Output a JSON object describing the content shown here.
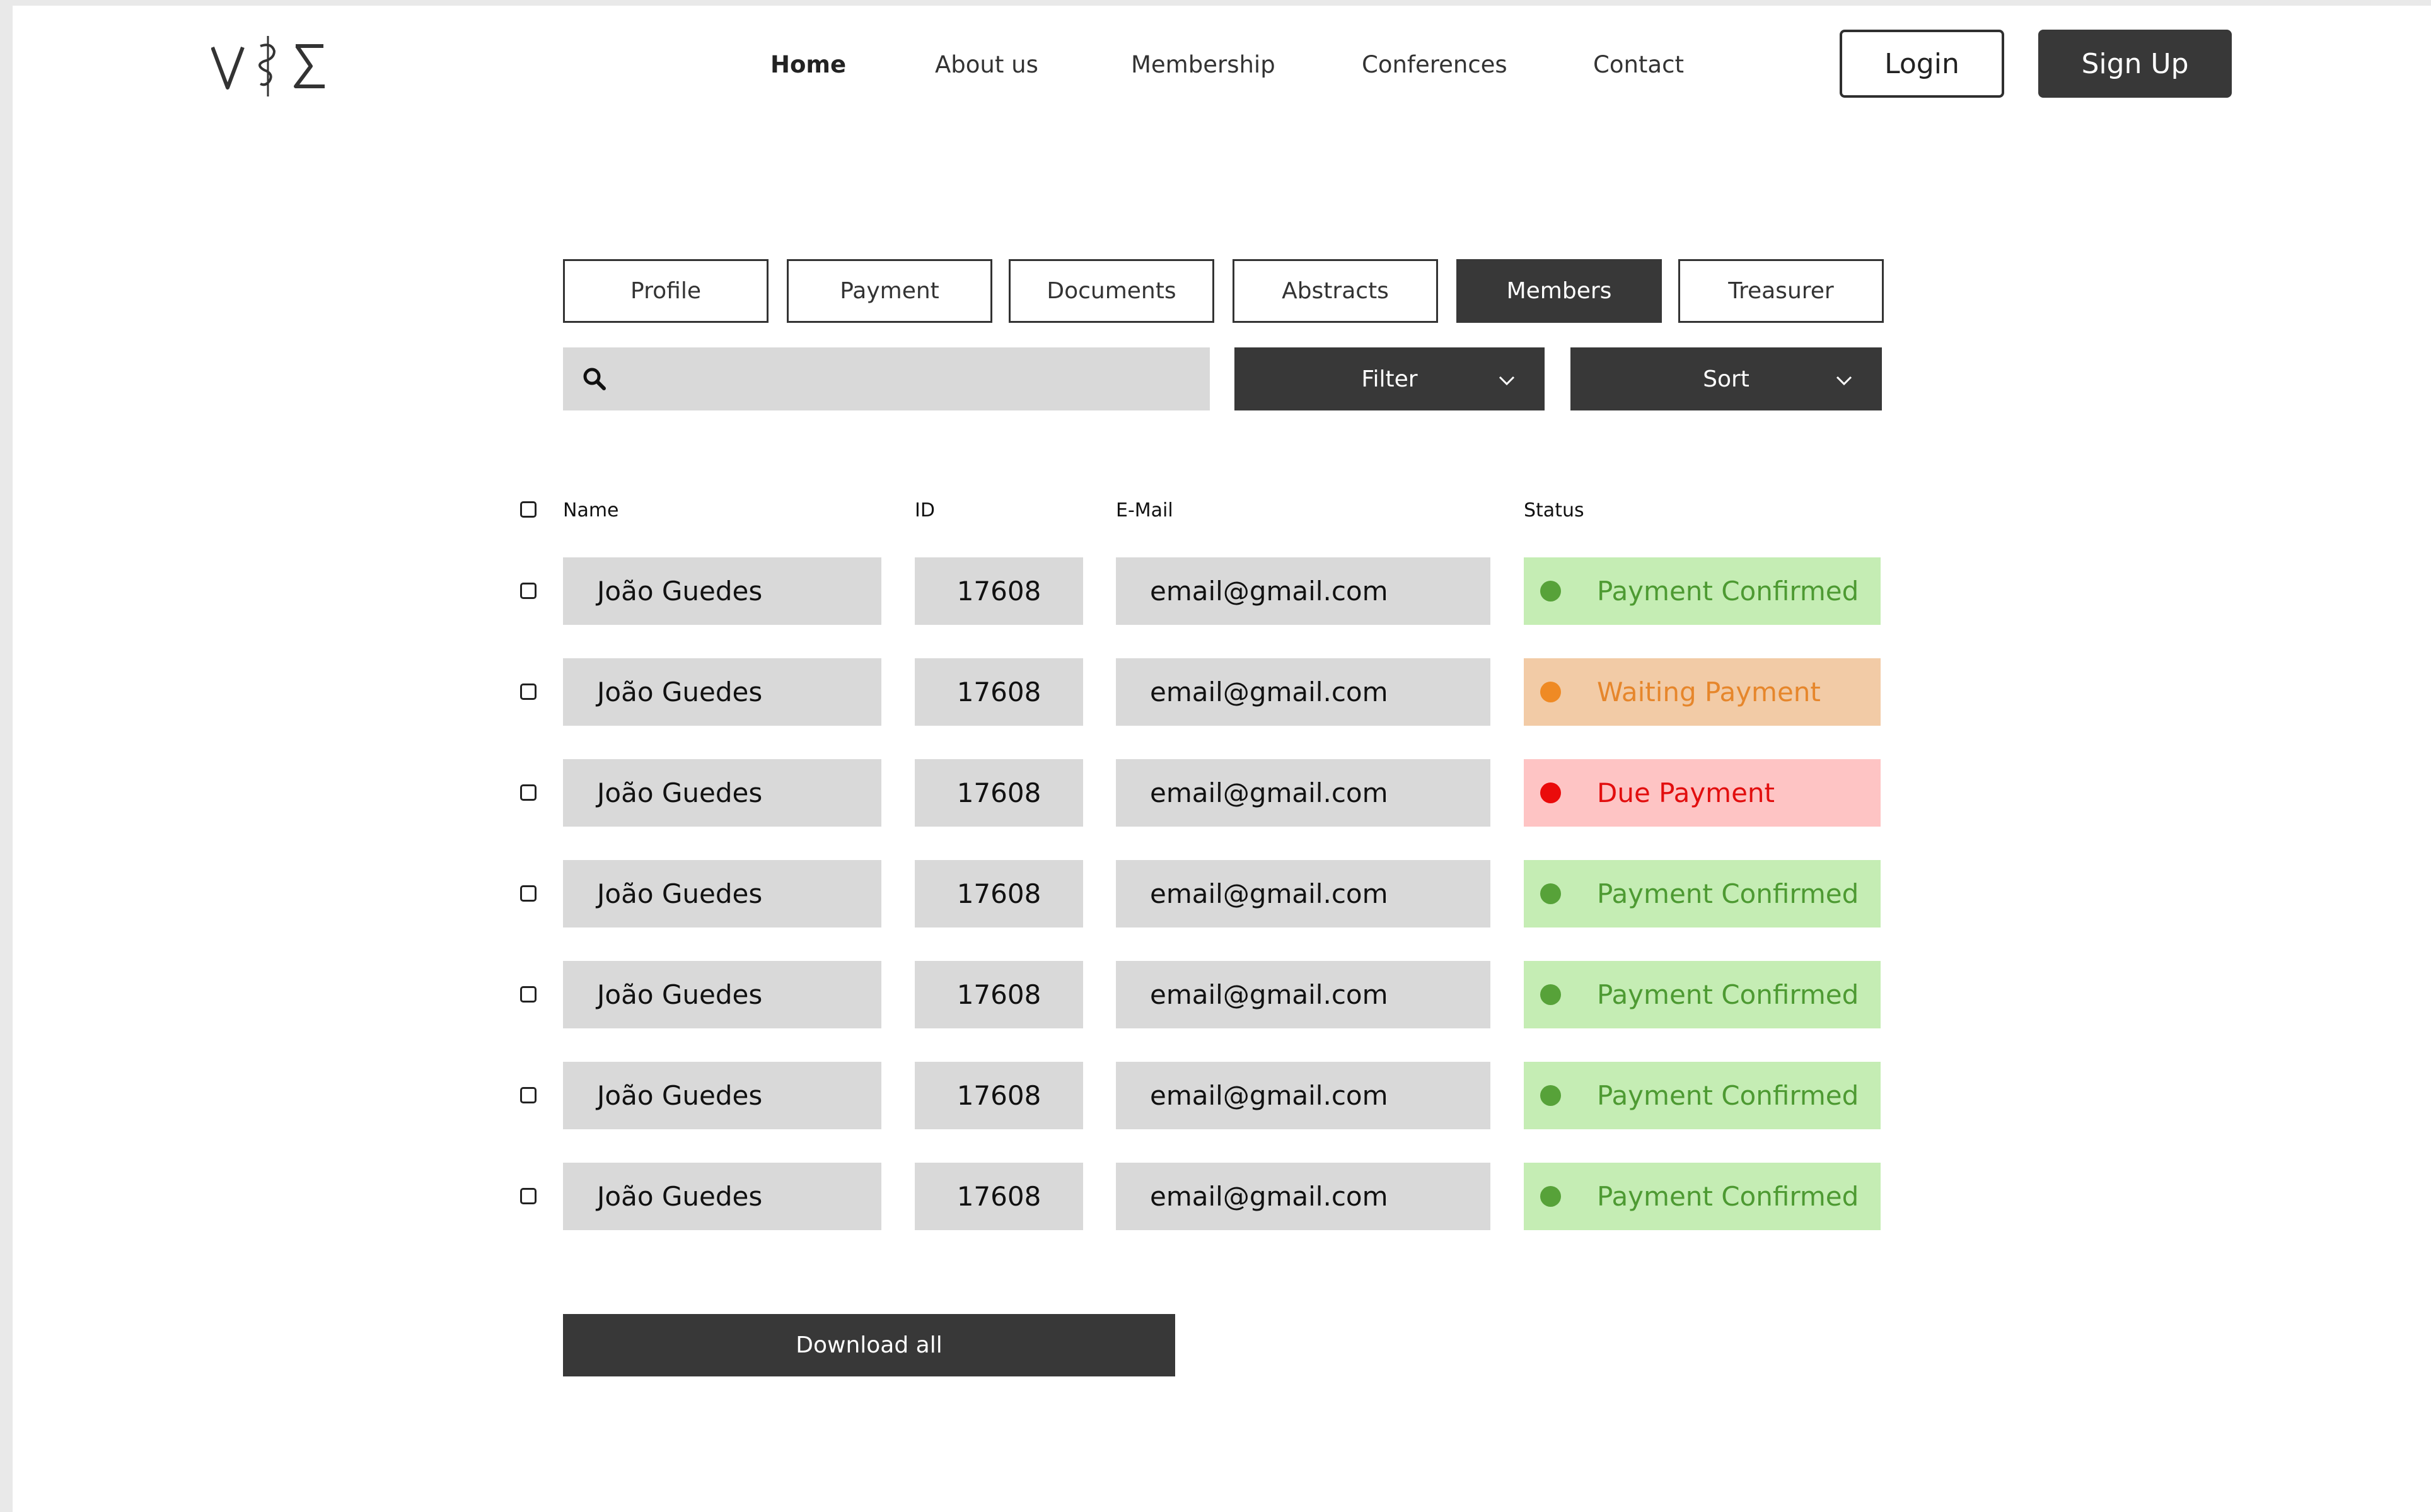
{
  "header": {
    "logo_name": "vise-logo",
    "nav": [
      "Home",
      "About us",
      "Membership",
      "Conferences",
      "Contact"
    ],
    "login_label": "Login",
    "signup_label": "Sign Up"
  },
  "tabs": [
    "Profile",
    "Payment",
    "Documents",
    "Abstracts",
    "Members",
    "Treasurer"
  ],
  "active_tab": "Members",
  "search": {
    "value": "",
    "placeholder": "",
    "icon": "search-icon"
  },
  "filter_label": "Filter",
  "sort_label": "Sort",
  "table": {
    "headers": {
      "name": "Name",
      "id": "ID",
      "email": "E-Mail",
      "status": "Status"
    },
    "rows": [
      {
        "name": "João Guedes",
        "id": "17608",
        "email": "email@gmail.com",
        "status": "Payment Confirmed"
      },
      {
        "name": "João Guedes",
        "id": "17608",
        "email": "email@gmail.com",
        "status": "Waiting Payment"
      },
      {
        "name": "João Guedes",
        "id": "17608",
        "email": "email@gmail.com",
        "status": "Due Payment"
      },
      {
        "name": "João Guedes",
        "id": "17608",
        "email": "email@gmail.com",
        "status": "Payment Confirmed"
      },
      {
        "name": "João Guedes",
        "id": "17608",
        "email": "email@gmail.com",
        "status": "Payment Confirmed"
      },
      {
        "name": "João Guedes",
        "id": "17608",
        "email": "email@gmail.com",
        "status": "Payment Confirmed"
      },
      {
        "name": "João Guedes",
        "id": "17608",
        "email": "email@gmail.com",
        "status": "Payment Confirmed"
      }
    ]
  },
  "status_colors": {
    "confirmed": "#57a239",
    "waiting": "#ef8a24",
    "due": "#ea0b0b"
  },
  "download_label": "Download all"
}
